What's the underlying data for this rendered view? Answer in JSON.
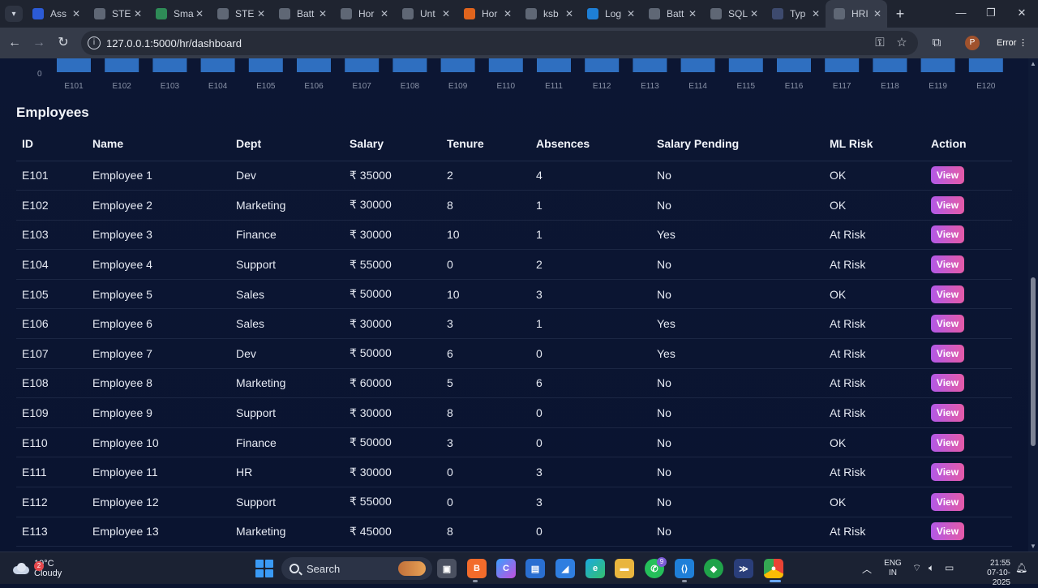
{
  "browser": {
    "tabs": [
      {
        "title": "Ass",
        "icon": "shield-icon",
        "color": "#2c5bd6"
      },
      {
        "title": "STE",
        "icon": "globe-icon",
        "color": "#5f6775"
      },
      {
        "title": "Sma",
        "icon": "map-pin-icon",
        "color": "#2e8b57"
      },
      {
        "title": "STE",
        "icon": "globe-icon",
        "color": "#5f6775"
      },
      {
        "title": "Batt",
        "icon": "globe-icon",
        "color": "#5f6775"
      },
      {
        "title": "Hor",
        "icon": "globe-icon",
        "color": "#5f6775"
      },
      {
        "title": "Unt",
        "icon": "globe-icon",
        "color": "#5f6775"
      },
      {
        "title": "Hor",
        "icon": "arc-icon",
        "color": "#e0641d"
      },
      {
        "title": "ksb",
        "icon": "globe-icon",
        "color": "#5f6775"
      },
      {
        "title": "Log",
        "icon": "c-logo-icon",
        "color": "#1e7fd6"
      },
      {
        "title": "Batt",
        "icon": "globe-icon",
        "color": "#5f6775"
      },
      {
        "title": "SQL",
        "icon": "gear-icon",
        "color": "#5f6775"
      },
      {
        "title": "Typ",
        "icon": "terminal-icon",
        "color": "#3d4a6e"
      },
      {
        "title": "HRI",
        "icon": "globe-icon",
        "color": "#5f6775",
        "active": true
      }
    ],
    "url": "127.0.0.1:5000/hr/dashboard",
    "profile_initial": "P",
    "status_chip": "Error"
  },
  "chart_data": {
    "type": "bar",
    "categories": [
      "E101",
      "E102",
      "E103",
      "E104",
      "E105",
      "E106",
      "E107",
      "E108",
      "E109",
      "E110",
      "E111",
      "E112",
      "E113",
      "E114",
      "E115",
      "E116",
      "E117",
      "E118",
      "E119",
      "E120"
    ],
    "y_tick_visible": "0",
    "bar_color": "#2f6fc0"
  },
  "employees": {
    "title": "Employees",
    "columns": [
      "ID",
      "Name",
      "Dept",
      "Salary",
      "Tenure",
      "Absences",
      "Salary Pending",
      "ML Risk",
      "Action"
    ],
    "rows": [
      [
        "E101",
        "Employee 1",
        "Dev",
        "₹ 35000",
        "2",
        "4",
        "No",
        "OK",
        "View"
      ],
      [
        "E102",
        "Employee 2",
        "Marketing",
        "₹ 30000",
        "8",
        "1",
        "No",
        "OK",
        "View"
      ],
      [
        "E103",
        "Employee 3",
        "Finance",
        "₹ 30000",
        "10",
        "1",
        "Yes",
        "At Risk",
        "View"
      ],
      [
        "E104",
        "Employee 4",
        "Support",
        "₹ 55000",
        "0",
        "2",
        "No",
        "At Risk",
        "View"
      ],
      [
        "E105",
        "Employee 5",
        "Sales",
        "₹ 50000",
        "10",
        "3",
        "No",
        "OK",
        "View"
      ],
      [
        "E106",
        "Employee 6",
        "Sales",
        "₹ 30000",
        "3",
        "1",
        "Yes",
        "At Risk",
        "View"
      ],
      [
        "E107",
        "Employee 7",
        "Dev",
        "₹ 50000",
        "6",
        "0",
        "Yes",
        "At Risk",
        "View"
      ],
      [
        "E108",
        "Employee 8",
        "Marketing",
        "₹ 60000",
        "5",
        "6",
        "No",
        "At Risk",
        "View"
      ],
      [
        "E109",
        "Employee 9",
        "Support",
        "₹ 30000",
        "8",
        "0",
        "No",
        "At Risk",
        "View"
      ],
      [
        "E110",
        "Employee 10",
        "Finance",
        "₹ 50000",
        "3",
        "0",
        "No",
        "OK",
        "View"
      ],
      [
        "E111",
        "Employee 11",
        "HR",
        "₹ 30000",
        "0",
        "3",
        "No",
        "At Risk",
        "View"
      ],
      [
        "E112",
        "Employee 12",
        "Support",
        "₹ 55000",
        "0",
        "3",
        "No",
        "OK",
        "View"
      ],
      [
        "E113",
        "Employee 13",
        "Marketing",
        "₹ 45000",
        "8",
        "0",
        "No",
        "At Risk",
        "View"
      ]
    ]
  },
  "taskbar": {
    "weather_temp": "19°C",
    "weather_desc": "Cloudy",
    "weather_badge": "2",
    "search_placeholder": "Search",
    "whatsapp_badge": "9",
    "lang_line1": "ENG",
    "lang_line2": "IN",
    "time": "21:55",
    "date": "07-10-2025",
    "accent": "#3a9af5"
  }
}
